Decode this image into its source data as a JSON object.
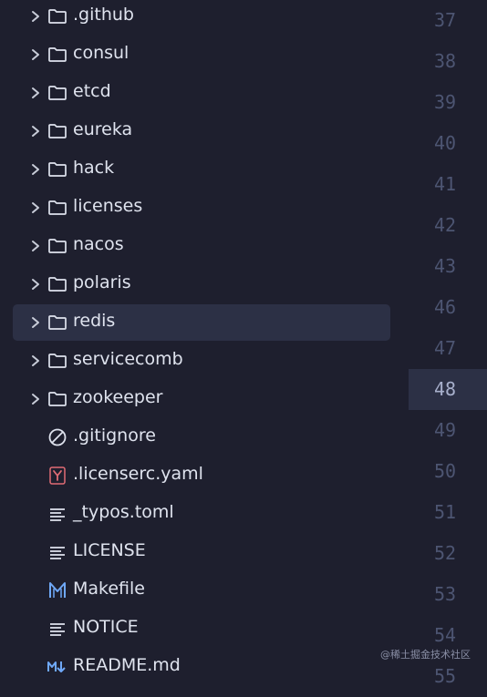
{
  "tree": {
    "items": [
      {
        "label": ".github",
        "icon": "folder-icon"
      },
      {
        "label": "consul",
        "icon": "folder-icon"
      },
      {
        "label": "etcd",
        "icon": "folder-icon"
      },
      {
        "label": "eureka",
        "icon": "folder-icon"
      },
      {
        "label": "hack",
        "icon": "folder-icon"
      },
      {
        "label": "licenses",
        "icon": "folder-icon"
      },
      {
        "label": "nacos",
        "icon": "folder-icon"
      },
      {
        "label": "polaris",
        "icon": "folder-icon"
      },
      {
        "label": "redis",
        "icon": "folder-icon",
        "selected": true
      },
      {
        "label": "servicecomb",
        "icon": "folder-icon"
      },
      {
        "label": "zookeeper",
        "icon": "folder-icon"
      },
      {
        "label": ".gitignore",
        "icon": "gitignore-icon"
      },
      {
        "label": ".licenserc.yaml",
        "icon": "yaml-icon"
      },
      {
        "label": "_typos.toml",
        "icon": "text-file-icon"
      },
      {
        "label": "LICENSE",
        "icon": "text-file-icon"
      },
      {
        "label": "Makefile",
        "icon": "makefile-icon"
      },
      {
        "label": "NOTICE",
        "icon": "text-file-icon"
      },
      {
        "label": "README.md",
        "icon": "markdown-icon"
      }
    ]
  },
  "gutter": {
    "lines": [
      "37",
      "38",
      "39",
      "40",
      "41",
      "42",
      "43",
      "46",
      "47",
      "48",
      "49",
      "50",
      "51",
      "52",
      "53",
      "54",
      "55"
    ],
    "active": "48"
  },
  "watermark": "@稀土掘金技术社区",
  "colors": {
    "background": "#1e1f2e",
    "selection": "#2c3045",
    "yaml": "#e06c75",
    "makefile": "#6fa8f7",
    "markdown": "#6fa8f7"
  }
}
